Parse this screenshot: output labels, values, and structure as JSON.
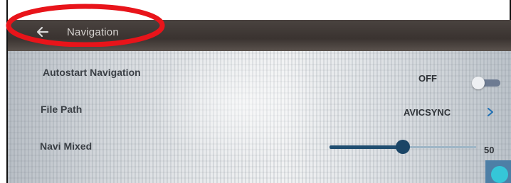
{
  "header": {
    "back_icon": "back-arrow-icon",
    "title": "Navigation"
  },
  "settings": {
    "autostart": {
      "label": "Autostart Navigation",
      "value": "OFF",
      "toggle_on": false
    },
    "file_path": {
      "label": "File Path",
      "value": "AVICSYNC",
      "chevron_icon": "chevron-right-icon"
    },
    "navi_mixed": {
      "label": "Navi Mixed",
      "value": "50",
      "slider_fraction": 0.5
    }
  },
  "colors": {
    "annotation_red": "#e8141a",
    "slider_fill": "#1f4d70",
    "toggle_track": "#6d7b92",
    "accent_cyan": "#35c6d8"
  }
}
